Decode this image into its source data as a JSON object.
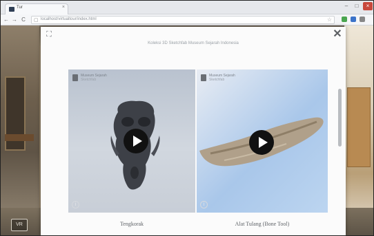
{
  "browser": {
    "tab_title": "Tur",
    "tab_close": "×",
    "url": "localhost/virtualtour/index.html",
    "win_min": "–",
    "win_max": "□",
    "win_close": "×",
    "back": "←",
    "forward": "→",
    "reload": "C",
    "star": "☆"
  },
  "modal": {
    "title": "Koleksi 3D Sketchfab Museum Sejarah Indonesia",
    "fullscreen_icon": "⛶",
    "close_icon": "✕",
    "items": [
      {
        "author": "Museum Sejarah",
        "author_sub": "Sketchfab",
        "caption": "Tengkorak",
        "info_icon": "i"
      },
      {
        "author": "Museum Sejarah",
        "author_sub": "Sketchfab",
        "caption": "Alat Tulang (Bone Tool)",
        "info_icon": "i"
      }
    ]
  },
  "scene": {
    "icon_label": "VR"
  },
  "colors": {
    "play_button": "#111111",
    "modal_bg": "#fbfbfb",
    "accent_close": "#c8483c"
  }
}
